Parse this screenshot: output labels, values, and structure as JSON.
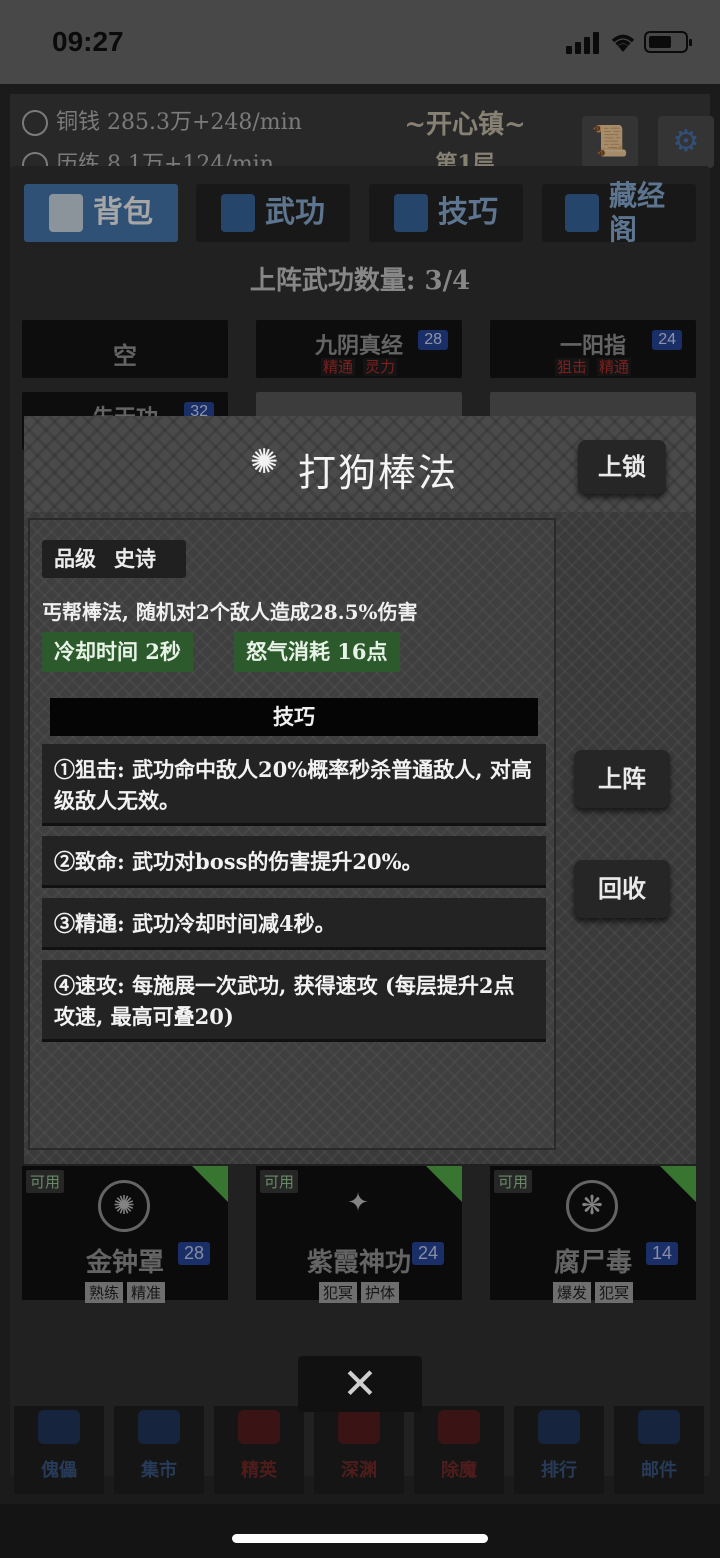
{
  "status_bar": {
    "time": "09:27"
  },
  "header": {
    "copper_label": "铜钱 285.3万+248/min",
    "training_label": "历练 8.1万+124/min",
    "location_title": "~开心镇~",
    "location_floor": "第1层"
  },
  "tabs": [
    {
      "label": "背包",
      "active": true
    },
    {
      "label": "武功",
      "active": false
    },
    {
      "label": "技巧",
      "active": false
    },
    {
      "label": "藏经阁",
      "active": false
    }
  ],
  "equip_count": "上阵武功数量: 3/4",
  "slots": [
    {
      "name": "空",
      "level": "",
      "tags": []
    },
    {
      "name": "九阴真经",
      "level": "28",
      "tags": [
        "精通",
        "灵力"
      ]
    },
    {
      "name": "一阳指",
      "level": "24",
      "tags": [
        "狙击",
        "精通"
      ]
    },
    {
      "name": "先天功",
      "level": "32",
      "tags": []
    }
  ],
  "cards": [
    {
      "available": "可用",
      "name": "金钟罩",
      "level": "28",
      "tags": [
        "熟练",
        "精准"
      ]
    },
    {
      "available": "可用",
      "name": "紫霞神功",
      "level": "24",
      "tags": [
        "犯冥",
        "护体"
      ]
    },
    {
      "available": "可用",
      "name": "腐尸毒",
      "level": "14",
      "tags": [
        "爆发",
        "犯冥"
      ]
    }
  ],
  "bottom_nav": [
    {
      "label": "傀儡",
      "color": "blue"
    },
    {
      "label": "集市",
      "color": "blue"
    },
    {
      "label": "精英",
      "color": "red"
    },
    {
      "label": "深渊",
      "color": "red"
    },
    {
      "label": "除魔",
      "color": "red"
    },
    {
      "label": "排行",
      "color": "blue"
    },
    {
      "label": "邮件",
      "color": "blue"
    }
  ],
  "modal": {
    "title": "打狗棒法",
    "lock_button": "上锁",
    "deploy_button": "上阵",
    "recycle_button": "回收",
    "grade_label": "品级",
    "grade_value": "史诗",
    "description": "丐帮棒法, 随机对2个敌人造成28.5%伤害",
    "cooldown": "冷却时间 2秒",
    "rage_cost": "怒气消耗 16点",
    "skills_header": "技巧",
    "skills": [
      "①狙击: 武功命中敌人20%概率秒杀普通敌人, 对高级敌人无效。",
      "②致命: 武功对boss的伤害提升20%。",
      "③精通: 武功冷却时间减4秒。",
      "④速攻: 每施展一次武功, 获得速攻 (每层提升2点攻速, 最高可叠20)"
    ]
  },
  "close_symbol": "✕"
}
